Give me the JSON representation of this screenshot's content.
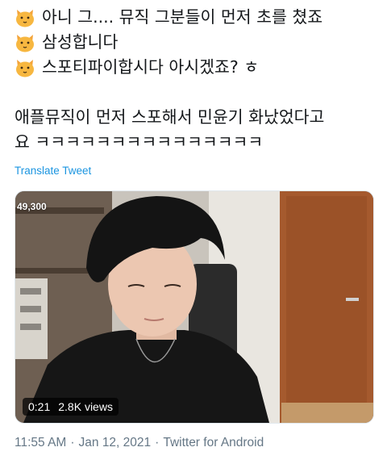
{
  "tweet": {
    "lines": [
      {
        "emoji": "cat-face-icon",
        "text": "아니 그.... 뮤직 그분들이 먼저 초를 쳤죠"
      },
      {
        "emoji": "cat-face-icon",
        "text": "삼성합니다"
      },
      {
        "emoji": "cat-face-icon",
        "text": "스포티파이합시다 아시겠죠? ㅎ"
      },
      {
        "emoji": "",
        "text": ""
      },
      {
        "emoji": "",
        "text": "애플뮤직이 먼저 스포해서 민윤기 화났었다고"
      },
      {
        "emoji": "",
        "text": "요 ㅋㅋㅋㅋㅋㅋㅋㅋㅋㅋㅋㅋㅋㅋㅋ"
      }
    ],
    "translate_label": "Translate Tweet"
  },
  "media": {
    "corner_count": "49,300",
    "duration": "0:21",
    "views": "2.8K views"
  },
  "footer": {
    "time": "11:55 AM",
    "sep1": "·",
    "date": "Jan 12, 2021",
    "sep2": "·",
    "source": "Twitter for Android"
  },
  "colors": {
    "link": "#1b95e0",
    "meta_text": "#657786",
    "text": "#14171a"
  }
}
